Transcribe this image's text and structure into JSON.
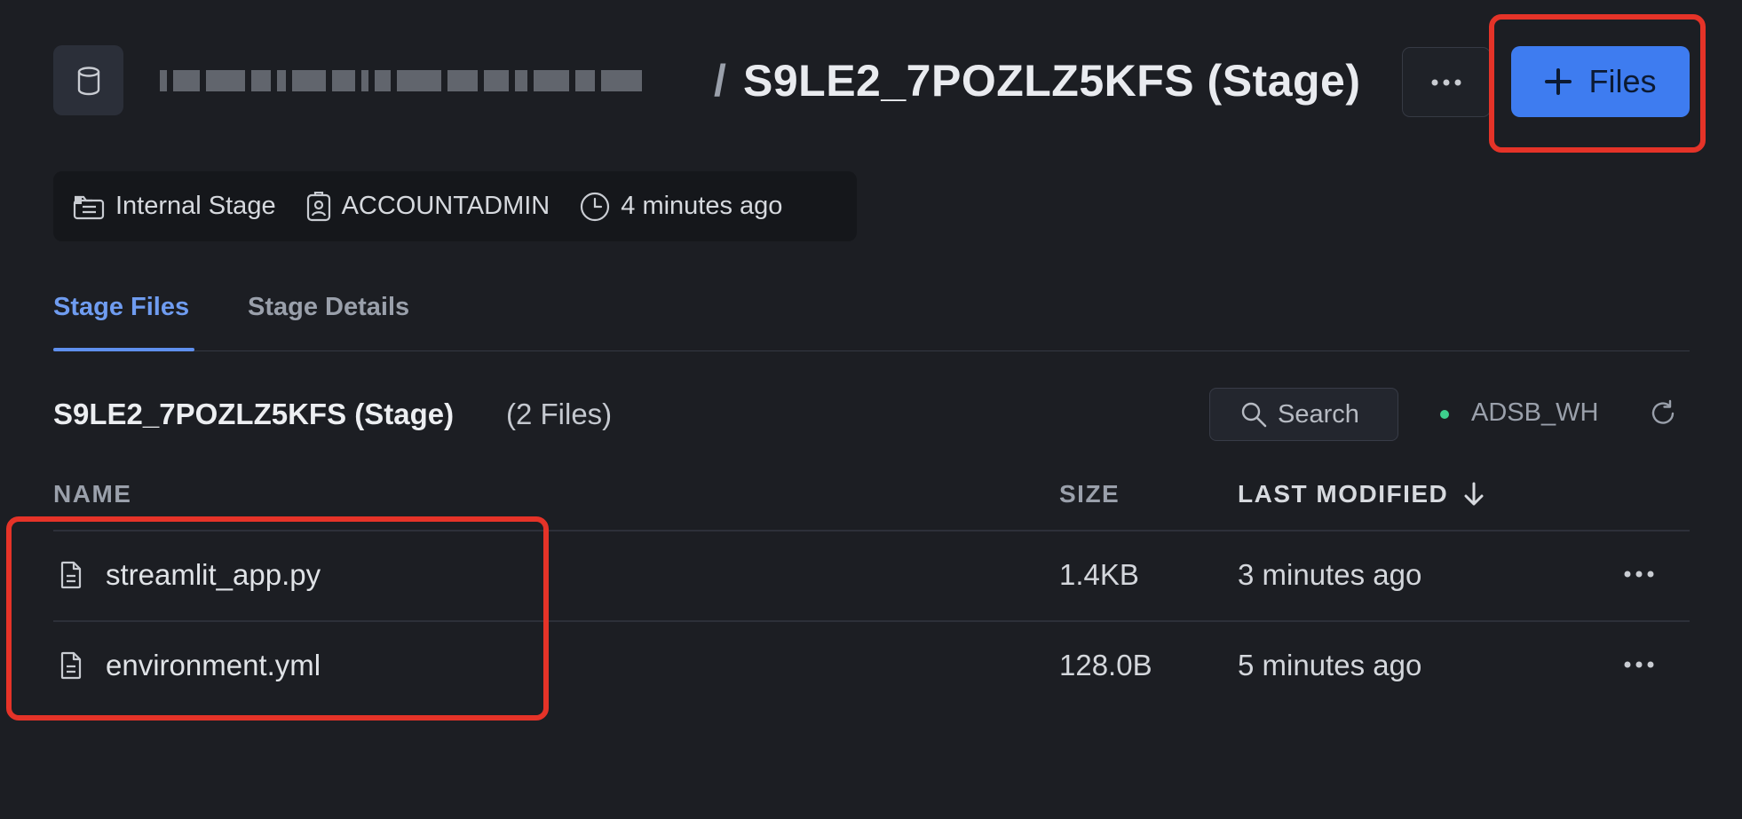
{
  "header": {
    "breadcrumb_redacted": "",
    "separator": "/",
    "title": "S9LE2_7POZLZ5KFS (Stage)",
    "more_icon": "ellipsis-icon",
    "files_button": {
      "icon": "plus-icon",
      "label": "Files"
    }
  },
  "meta": {
    "stage_type": "Internal Stage",
    "owner": "ACCOUNTADMIN",
    "created": "4 minutes ago"
  },
  "tabs": [
    {
      "label": "Stage Files",
      "active": true
    },
    {
      "label": "Stage Details",
      "active": false
    }
  ],
  "section": {
    "title": "S9LE2_7POZLZ5KFS (Stage)",
    "count": "(2 Files)",
    "search_label": "Search",
    "warehouse": "ADSB_WH",
    "warehouse_status_color": "#3ecf8e"
  },
  "table": {
    "columns": [
      "NAME",
      "SIZE",
      "LAST MODIFIED"
    ],
    "sort_column": "LAST MODIFIED",
    "sort_direction": "descending",
    "rows": [
      {
        "name": "streamlit_app.py",
        "size": "1.4KB",
        "modified": "3 minutes ago"
      },
      {
        "name": "environment.yml",
        "size": "128.0B",
        "modified": "5 minutes ago"
      }
    ]
  },
  "colors": {
    "background": "#1c1e23",
    "accent": "#3e7cf0",
    "highlight": "#e53328"
  }
}
